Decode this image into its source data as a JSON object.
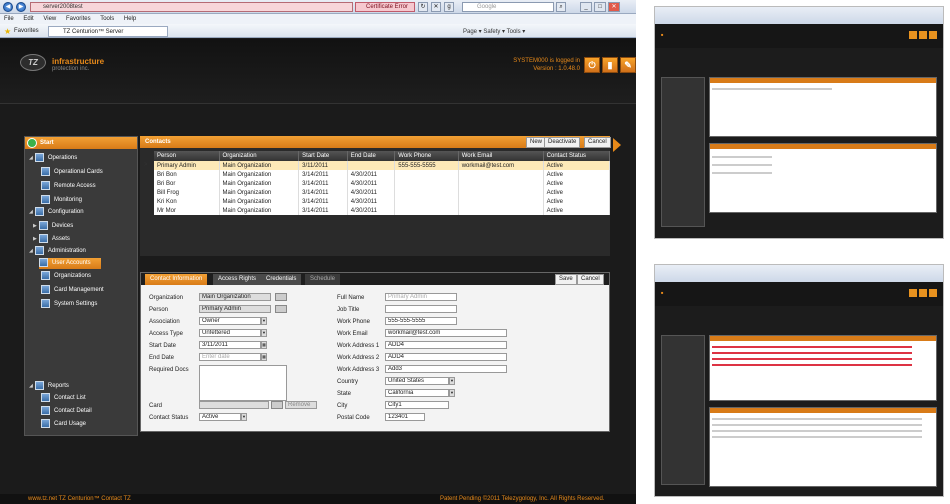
{
  "browser": {
    "address": "server2008test",
    "cert_error": "Certificate Error",
    "search_placeholder": "Google",
    "menu": [
      "File",
      "Edit",
      "View",
      "Favorites",
      "Tools",
      "Help"
    ],
    "favorites_label": "Favorites",
    "tab_title": "TZ Centurion™ Server",
    "command_bar": "Page ▾  Safety ▾  Tools ▾"
  },
  "header": {
    "logo_line1": "infrastructure",
    "logo_line2": "protection inc.",
    "logo_mark": "TZ",
    "system_line1": "SYSTEM000 is logged in",
    "system_line2": "Version : 1.0.48.0"
  },
  "nav": {
    "top_label": "Start",
    "items": [
      {
        "label": "Operations"
      },
      {
        "label": "Operational Cards"
      },
      {
        "label": "Remote Access"
      },
      {
        "label": "Monitoring"
      },
      {
        "label": "Configuration"
      },
      {
        "label": "Devices"
      },
      {
        "label": "Assets"
      },
      {
        "label": "Administration"
      },
      {
        "label": "User Accounts"
      },
      {
        "label": "Organizations"
      },
      {
        "label": "Card Management"
      },
      {
        "label": "System Settings"
      },
      {
        "label": "Reports"
      },
      {
        "label": "Contact List"
      },
      {
        "label": "Contact Detail"
      },
      {
        "label": "Card Usage"
      }
    ]
  },
  "contacts": {
    "title": "Contacts",
    "buttons": {
      "new": "New",
      "deactivate": "Deactivate",
      "cancel": "Cancel"
    },
    "columns": [
      "Person",
      "Organization",
      "Start Date",
      "End Date",
      "Work Phone",
      "Work Email",
      "Contact Status"
    ],
    "rows": [
      [
        "Primary Admin",
        "Main Organization",
        "3/11/2011",
        "",
        "555-555-5555",
        "workmail@test.com",
        "Active"
      ],
      [
        "Bri Bon",
        "Main Organization",
        "3/14/2011",
        "4/30/2011",
        "",
        "",
        "Active"
      ],
      [
        "Bri Bor",
        "Main Organization",
        "3/14/2011",
        "4/30/2011",
        "",
        "",
        "Active"
      ],
      [
        "Bill Frog",
        "Main Organization",
        "3/14/2011",
        "4/30/2011",
        "",
        "",
        "Active"
      ],
      [
        "Kri Kon",
        "Main Organization",
        "3/14/2011",
        "4/30/2011",
        "",
        "",
        "Active"
      ],
      [
        "Mr Mor",
        "Main Organization",
        "3/14/2011",
        "4/30/2011",
        "",
        "",
        "Active"
      ]
    ]
  },
  "detail": {
    "tabs": [
      "Contact Information",
      "Access Rights",
      "Credentials",
      "Schedule"
    ],
    "save": "Save",
    "cancel": "Cancel",
    "left": {
      "organization_label": "Organization",
      "organization": "Main Organization",
      "person_label": "Person",
      "person": "Primary Admin",
      "association_label": "Association",
      "association": "Owner",
      "access_type_label": "Access Type",
      "access_type": "Unfettered",
      "start_date_label": "Start Date",
      "start_date": "3/11/2011",
      "end_date_label": "End Date",
      "end_date_placeholder": "Enter date",
      "required_docs_label": "Required Docs",
      "card_label": "Card",
      "remove_label": "Remove",
      "contact_status_label": "Contact Status",
      "contact_status": "Active"
    },
    "right": {
      "full_name_label": "Full Name",
      "full_name": "Primary Admin",
      "job_title_label": "Job Title",
      "work_phone_label": "Work Phone",
      "work_phone": "555-555-5555",
      "work_email_label": "Work Email",
      "work_email": "workmail@test.com",
      "addr1_label": "Work Address 1",
      "addr1": "ADD4",
      "addr2_label": "Work Address 2",
      "addr2": "ADD4",
      "addr3_label": "Work Address 3",
      "addr3": "Add3",
      "country_label": "Country",
      "country": "United States",
      "state_label": "State",
      "state": "California",
      "city_label": "City",
      "city": "City1",
      "postal_label": "Postal Code",
      "postal": "123401"
    }
  },
  "footer": {
    "left": "www.tz.net   TZ Centurion™   Contact TZ",
    "right": "Patent Pending ©2011 Telezygology, Inc. All Rights Reserved."
  },
  "colors": {
    "accent": "#e88a1a",
    "background": "#1b1b1b",
    "selected_row": "#fde9b8"
  }
}
